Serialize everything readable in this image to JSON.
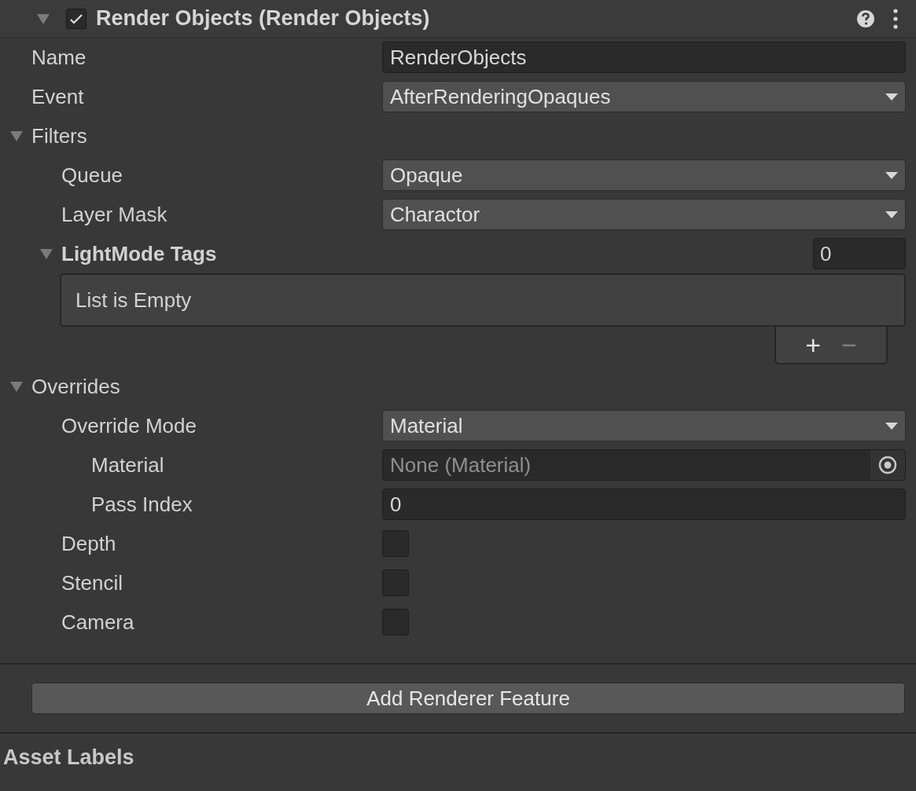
{
  "header": {
    "title": "Render Objects (Render Objects)",
    "expanded": true,
    "enabled": true
  },
  "properties": [
    {
      "kind": "text",
      "label": "Name",
      "value": "RenderObjects"
    },
    {
      "kind": "dropdown",
      "label": "Event",
      "value": "AfterRenderingOpaques"
    },
    {
      "kind": "foldout",
      "label": "Filters",
      "expanded": true,
      "children": [
        {
          "kind": "dropdown",
          "label": "Queue",
          "value": "Opaque"
        },
        {
          "kind": "dropdown",
          "label": "Layer Mask",
          "value": "Charactor"
        },
        {
          "kind": "list",
          "label": "LightMode Tags",
          "expanded": true,
          "count": "0",
          "empty_text": "List is Empty",
          "add": "+",
          "remove": "−"
        }
      ]
    },
    {
      "kind": "foldout",
      "label": "Overrides",
      "expanded": true,
      "children": [
        {
          "kind": "dropdown",
          "label": "Override Mode",
          "value": "Material",
          "children": [
            {
              "kind": "object",
              "label": "Material",
              "placeholder": "None (Material)"
            },
            {
              "kind": "text",
              "label": "Pass Index",
              "value": "0"
            }
          ]
        },
        {
          "kind": "checkbox",
          "label": "Depth",
          "checked": false
        },
        {
          "kind": "checkbox",
          "label": "Stencil",
          "checked": false
        },
        {
          "kind": "checkbox",
          "label": "Camera",
          "checked": false
        }
      ]
    }
  ],
  "add_button": "Add Renderer Feature",
  "footer_title": "Asset Labels"
}
